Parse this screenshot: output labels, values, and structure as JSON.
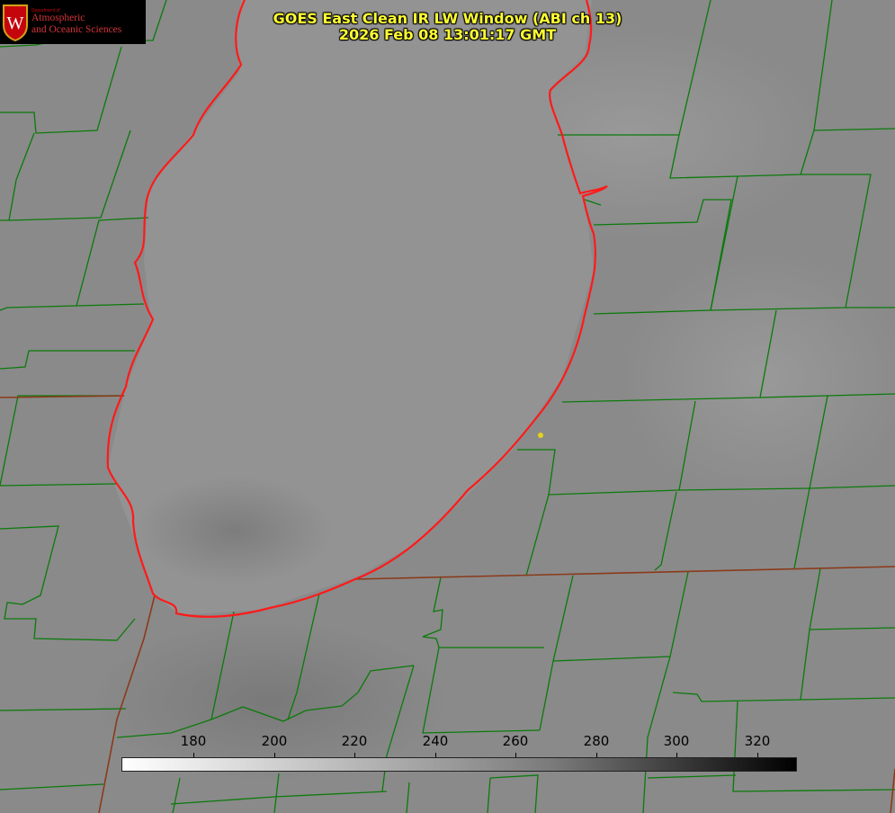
{
  "logo": {
    "department": "Department of",
    "line1": "Atmospheric",
    "line2": "and Oceanic Sciences",
    "crest_letter": "W"
  },
  "title": {
    "line1": "GOES East Clean IR LW Window (ABI ch 13)",
    "line2": "2026 Feb 08 13:01:17 GMT"
  },
  "colorbar": {
    "ticks": [
      "180",
      "200",
      "220",
      "240",
      "260",
      "280",
      "300",
      "320"
    ],
    "colors": {
      "low": "#ffffff",
      "mid": "#7a7a7a",
      "high": "#000000"
    }
  },
  "map": {
    "colors": {
      "background": "#8a8a8a",
      "lake": "#939393",
      "county_lines": "#0b7a0b",
      "state_lines": "#8b3a1a",
      "shoreline": "#ff1a1a",
      "marker": "#e6d21a",
      "title_text": "#ffff33"
    }
  }
}
